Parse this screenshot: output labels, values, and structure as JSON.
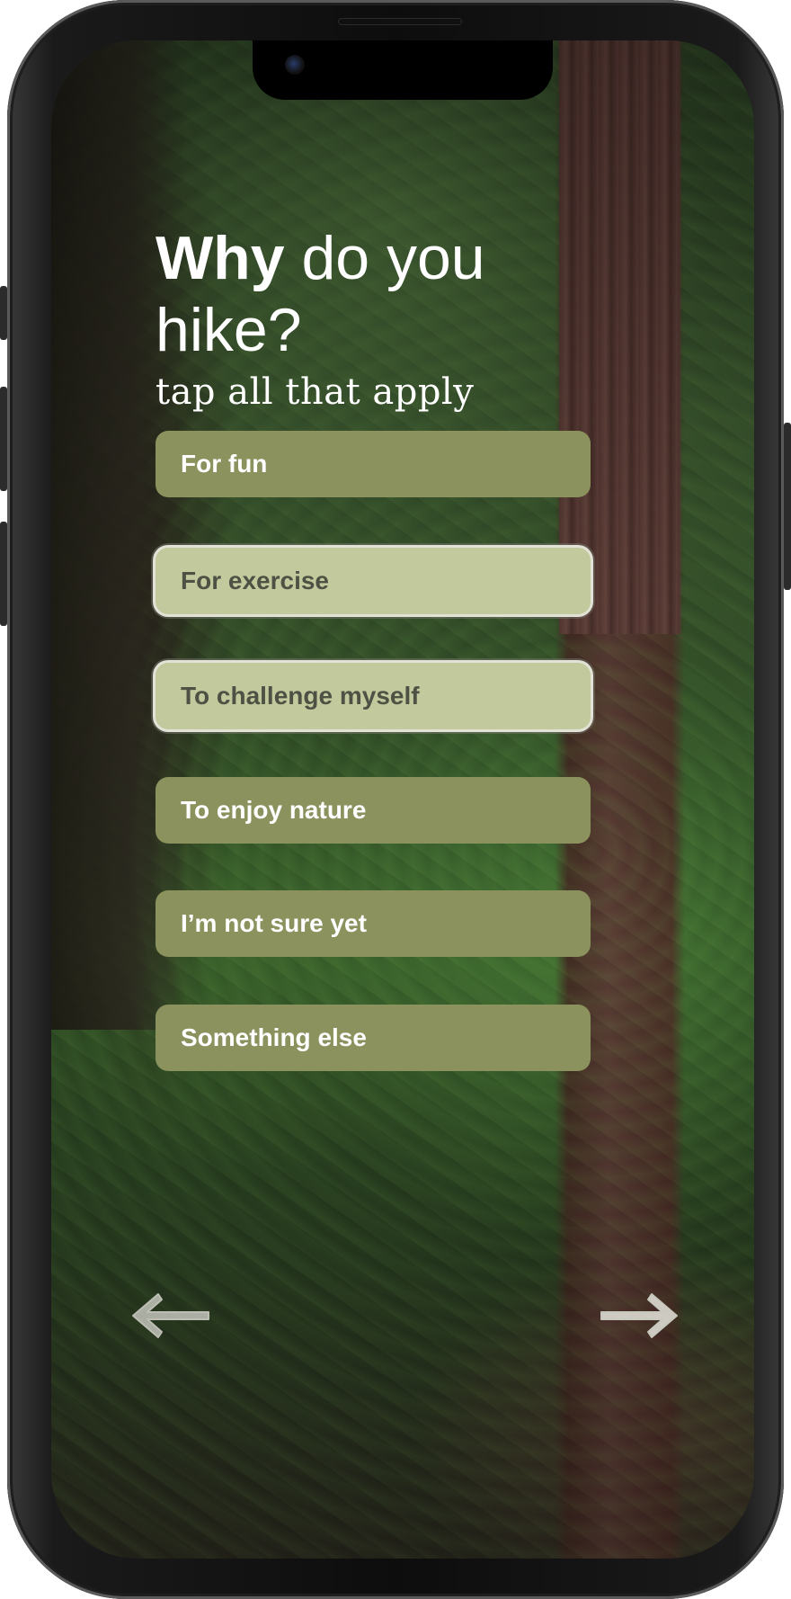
{
  "question": {
    "title_bold": "Why",
    "title_rest": " do you hike?",
    "subtitle": "tap all that apply"
  },
  "options": [
    {
      "label": "For fun",
      "selected": false
    },
    {
      "label": "For exercise",
      "selected": true
    },
    {
      "label": "To challenge myself",
      "selected": true
    },
    {
      "label": "To enjoy nature",
      "selected": false
    },
    {
      "label": "I’m not sure yet",
      "selected": false
    },
    {
      "label": "Something else",
      "selected": false
    }
  ],
  "navigation": {
    "back_icon": "arrow-left-icon",
    "next_icon": "arrow-right-icon"
  },
  "colors": {
    "option_unselected": "#8b925e",
    "option_selected": "#c2c99d",
    "selected_text": "#4e5244",
    "text_light": "#ffffff"
  }
}
